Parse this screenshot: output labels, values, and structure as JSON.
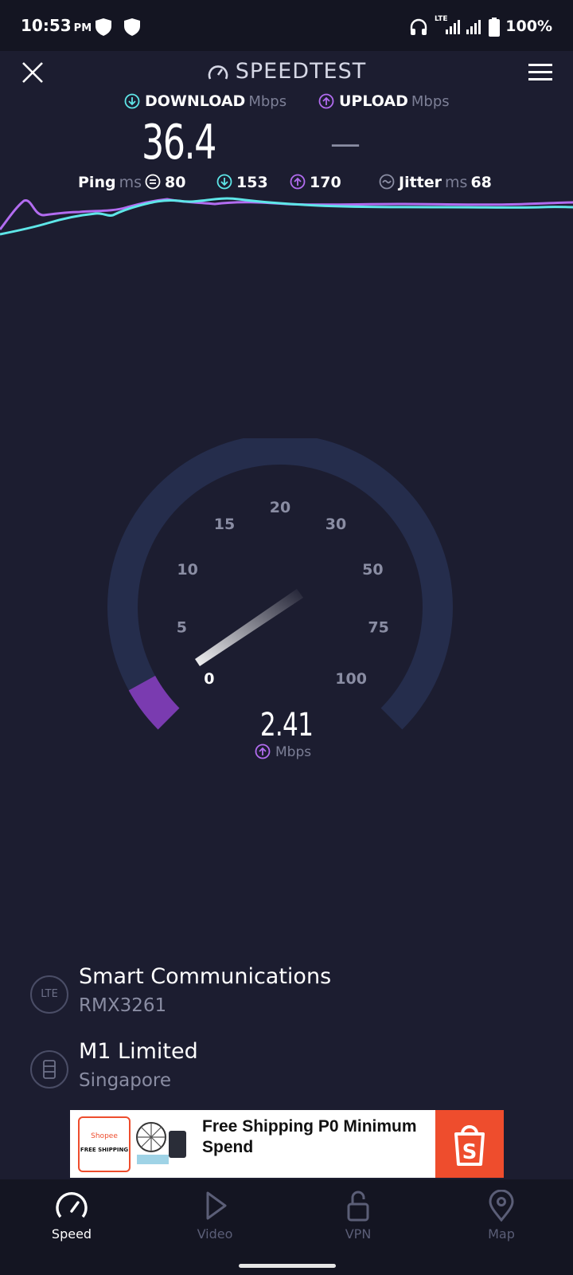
{
  "status_bar": {
    "time": "10:53",
    "ampm": "PM",
    "network": "LTE",
    "battery": "100%"
  },
  "header": {
    "title": "SPEEDTEST",
    "download_label": "DOWNLOAD",
    "upload_label": "UPLOAD",
    "unit": "Mbps",
    "download_value": "36.4",
    "upload_value": "—"
  },
  "stats": {
    "ping_label": "Ping",
    "ping_unit": "ms",
    "ping_idle": "80",
    "ping_download": "153",
    "ping_upload": "170",
    "jitter_label": "Jitter",
    "jitter_unit": "ms",
    "jitter_value": "68"
  },
  "gauge": {
    "ticks": [
      "0",
      "5",
      "10",
      "15",
      "20",
      "30",
      "50",
      "75",
      "100"
    ],
    "current_value": "2.41",
    "unit": "Mbps",
    "mode": "upload"
  },
  "provider": {
    "icon_label": "LTE",
    "name": "Smart Communications",
    "device": "RMX3261"
  },
  "server": {
    "name": "M1 Limited",
    "location": "Singapore"
  },
  "ad": {
    "brand": "Shopee",
    "badge": "FREE SHIPPING",
    "text": "Free Shipping P0 Minimum Spend",
    "logo_letter": "S"
  },
  "nav": {
    "items": [
      {
        "label": "Speed",
        "icon": "speedometer-icon",
        "active": true
      },
      {
        "label": "Video",
        "icon": "play-icon",
        "active": false
      },
      {
        "label": "VPN",
        "icon": "lock-icon",
        "active": false
      },
      {
        "label": "Map",
        "icon": "map-pin-icon",
        "active": false
      }
    ]
  },
  "colors": {
    "background": "#1c1d30",
    "download_accent": "#5ee6e8",
    "upload_accent": "#b26cf0",
    "gauge_track": "#252d4c",
    "ad_brand": "#ee4d2d"
  }
}
